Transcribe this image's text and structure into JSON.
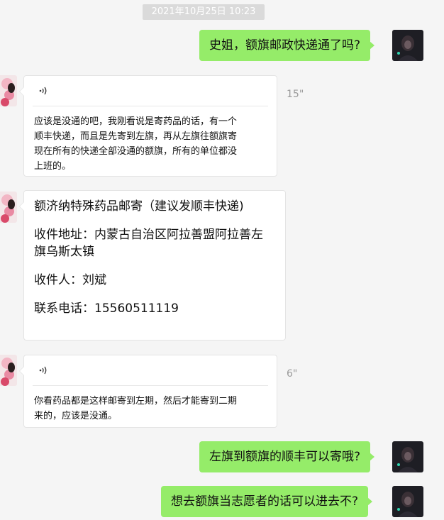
{
  "timestamp": "2021年10月25日 10:23",
  "messages": {
    "m1": {
      "text": "史姐，额旗邮政快递通了吗?"
    },
    "m2": {
      "duration": "15\"",
      "transcript_lines": [
        "应该是没通的吧，我刚看说是寄药品的话，有一个",
        "顺丰快递，而且是先寄到左旗，再从左旗往额旗寄",
        "现在所有的快递全部没通的额旗，所有的单位都没",
        "上班的。"
      ]
    },
    "m3": {
      "lines": [
        "额济纳特殊药品邮寄（建议发顺丰快递)",
        "收件地址：内蒙古自治区阿拉善盟阿拉善左",
        "旗乌斯太镇",
        "收件人：刘斌",
        "联系电话：15560511119"
      ]
    },
    "m4": {
      "duration": "6\"",
      "transcript_lines": [
        "你看药品都是这样邮寄到左期，然后才能寄到二期",
        "来的，应该是没通。"
      ]
    },
    "m5": {
      "text": "左旗到额旗的顺丰可以寄哦?"
    },
    "m6": {
      "text": "想去额旗当志愿者的话可以进去不?"
    }
  },
  "icons": {
    "voice": "voice-wave-icon",
    "self_avatar": "dark-portrait-avatar",
    "other_avatar": "pink-floral-avatar"
  },
  "colors": {
    "self_bubble": "#95ec69",
    "other_bubble": "#ffffff",
    "background": "#f5f5f5"
  }
}
